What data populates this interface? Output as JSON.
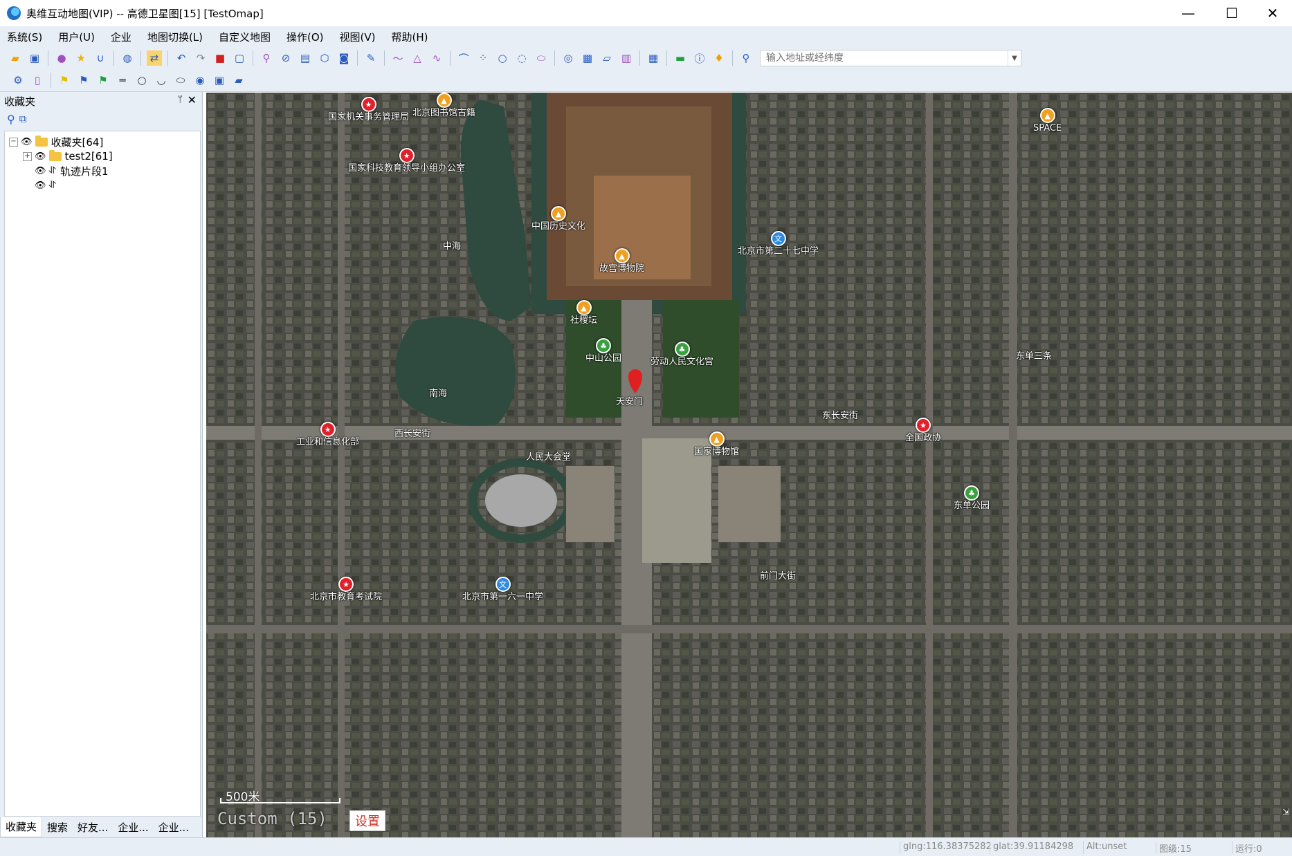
{
  "window": {
    "title": "奥维互动地图(VIP) -- 高德卫星图[15] [TestOmap]",
    "minimize": "—",
    "maximize": "☐",
    "close": "✕"
  },
  "menu": [
    "系统(S)",
    "用户(U)",
    "企业",
    "地图切换(L)",
    "自定义地图",
    "操作(O)",
    "视图(V)",
    "帮助(H)"
  ],
  "search": {
    "placeholder": "输入地址或经纬度"
  },
  "panel": {
    "title": "收藏夹",
    "pin": "ᛘ",
    "close": "✕",
    "tree": [
      {
        "label": "收藏夹[64]"
      },
      {
        "label": "test2[61]"
      },
      {
        "label": "轨迹片段1"
      },
      {
        "label": ""
      }
    ],
    "tabs": [
      "收藏夹",
      "搜索",
      "好友...",
      "企业...",
      "企业..."
    ]
  },
  "map": {
    "scale_label": "500米",
    "level_label": "Custom (15)",
    "settings_button": "设置",
    "colors": {
      "satellite_bg": "#3c4038",
      "road": "#7d7b73",
      "water": "#2f4a3e",
      "park": "#2f4d2a"
    },
    "pois": [
      {
        "name": "国家机关事务管理局",
        "color": "#e0202a",
        "icon": "★"
      },
      {
        "name": "北京图书馆古籍",
        "color": "#f0a020",
        "icon": "▲"
      },
      {
        "name": "国家科技教育领导小组办公室",
        "color": "#e0202a",
        "icon": "★"
      },
      {
        "name": "天安门",
        "color": "#e0202a",
        "icon": "♦"
      },
      {
        "name": "故宫博物院",
        "color": "#f0a020",
        "icon": "▲"
      },
      {
        "name": "中海",
        "color": "",
        "icon": ""
      },
      {
        "name": "南海",
        "color": "",
        "icon": ""
      },
      {
        "name": "中山公园",
        "color": "#3aa040",
        "icon": "♣"
      },
      {
        "name": "劳动人民文化宫",
        "color": "#3aa040",
        "icon": "♣"
      },
      {
        "name": "人民大会堂",
        "color": "",
        "icon": ""
      },
      {
        "name": "北京市第一六一中学",
        "color": "#2d8ae0",
        "icon": "文"
      },
      {
        "name": "东单公园",
        "color": "#3aa040",
        "icon": "♣"
      },
      {
        "name": "北京市第二十七中学",
        "color": "#2d8ae0",
        "icon": "文"
      },
      {
        "name": "西长安街",
        "color": "",
        "icon": ""
      },
      {
        "name": "东长安街",
        "color": "",
        "icon": ""
      },
      {
        "name": "全国政协",
        "color": "#e0202a",
        "icon": "★"
      },
      {
        "name": "工业和信息化部",
        "color": "#e0202a",
        "icon": "★"
      },
      {
        "name": "国家博物馆",
        "color": "#f0a020",
        "icon": "▲"
      },
      {
        "name": "前门大街",
        "color": "",
        "icon": ""
      },
      {
        "name": "北京市教育考试院",
        "color": "#e0202a",
        "icon": "★"
      },
      {
        "name": "SPACE",
        "color": "#f0a020",
        "icon": "▲"
      },
      {
        "name": "东单三条",
        "color": "",
        "icon": ""
      },
      {
        "name": "中国历史文化",
        "color": "#f0a020",
        "icon": "▲"
      },
      {
        "name": "社稷坛",
        "color": "#f0a020",
        "icon": "▲"
      }
    ]
  },
  "status": {
    "glng": "glng:116.38375282",
    "glat": "glat:39.91184298",
    "alt": "Alt:unset",
    "level": "图级:15",
    "run": "运行:0"
  }
}
